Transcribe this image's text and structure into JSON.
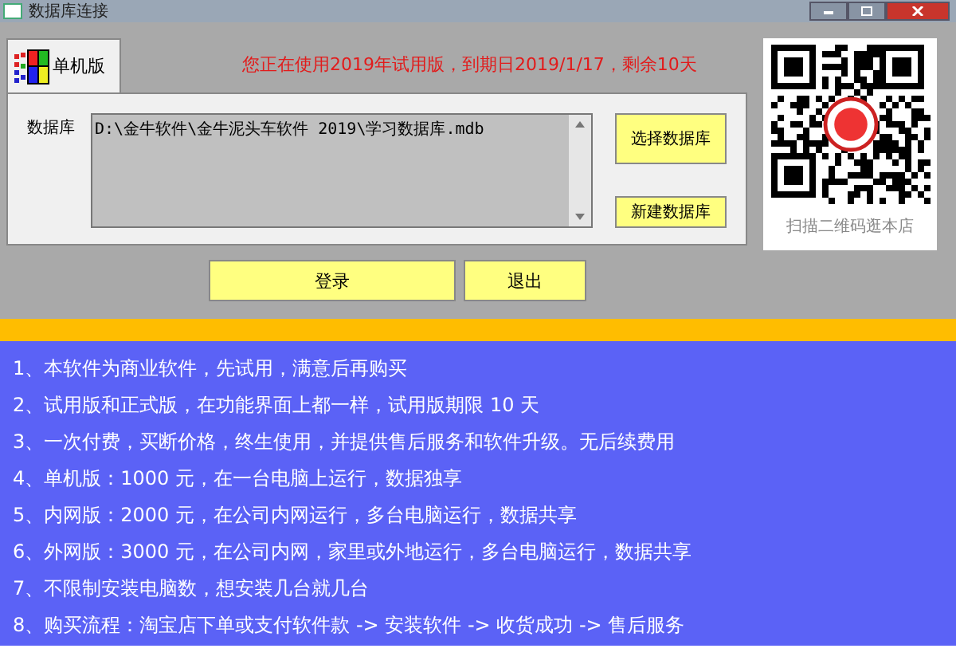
{
  "window": {
    "title": "数据库连接"
  },
  "notice": "您正在使用2019年试用版，到期日2019/1/17，剩余10天",
  "tabs": [
    {
      "label": "单机版",
      "selected": true
    }
  ],
  "database": {
    "label": "数据库",
    "value": "D:\\金牛软件\\金牛泥头车软件 2019\\学习数据库.mdb"
  },
  "side_buttons": [
    "选择数据库",
    "新建数据库"
  ],
  "qr": {
    "caption": "扫描二维码逛本店"
  },
  "buttons": [
    "登录",
    "退出"
  ],
  "notes": [
    "1、本软件为商业软件，先试用，满意后再购买",
    "2、试用版和正式版，在功能界面上都一样，试用版期限 10 天",
    "3、一次付费，买断价格，终生使用，并提供售后服务和软件升级。无后续费用",
    "4、单机版：1000 元，在一台电脑上运行，数据独享",
    "5、内网版：2000 元，在公司内网运行，多台电脑运行，数据共享",
    "6、外网版：3000 元，在公司内网，家里或外地运行，多台电脑运行，数据共享",
    "7、不限制安装电脑数，想安装几台就几台",
    "8、购买流程：淘宝店下单或支付软件款 -> 安装软件 -> 收货成功 -> 售后服务"
  ]
}
